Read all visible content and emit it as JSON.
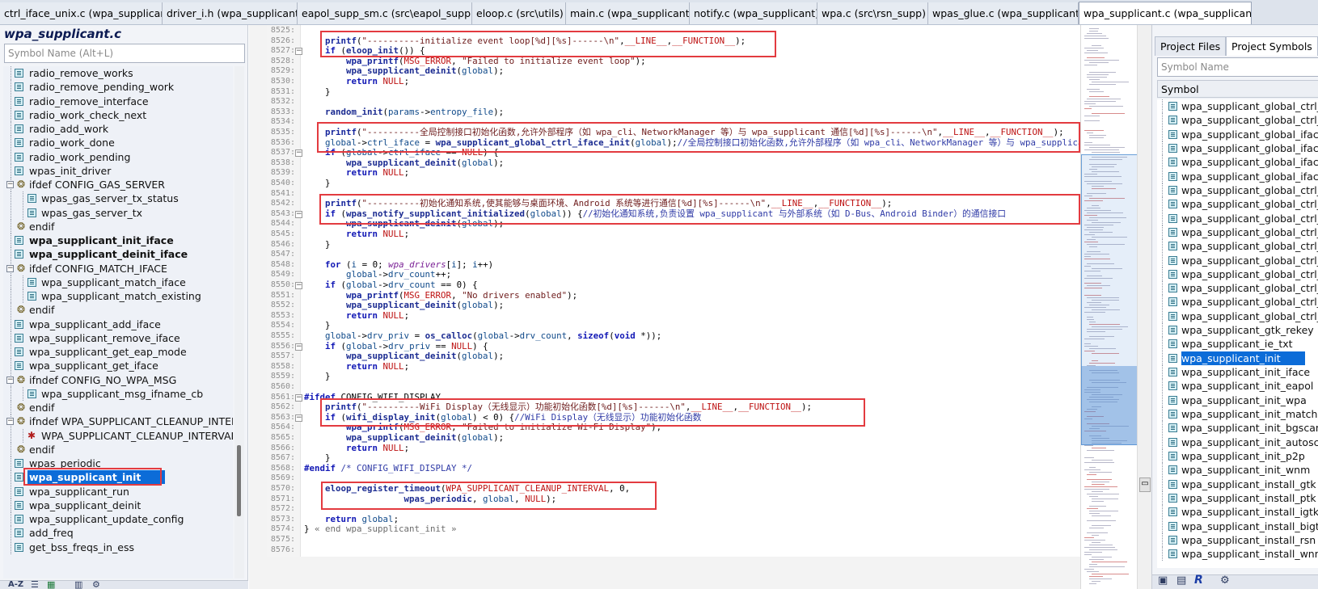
{
  "tabs": [
    {
      "label": "ctrl_iface_unix.c (wpa_supplicant)",
      "active": false
    },
    {
      "label": "driver_i.h (wpa_supplicant)",
      "active": false
    },
    {
      "label": "eapol_supp_sm.c (src\\eapol_supp)",
      "active": false
    },
    {
      "label": "eloop.c (src\\utils)",
      "active": false
    },
    {
      "label": "main.c (wpa_supplicant)",
      "active": false
    },
    {
      "label": "notify.c (wpa_supplicant)",
      "active": false
    },
    {
      "label": "wpa.c (src\\rsn_supp)",
      "active": false
    },
    {
      "label": "wpas_glue.c (wpa_supplicant)",
      "active": false
    },
    {
      "label": "wpa_supplicant.c (wpa_supplicant)",
      "active": true
    }
  ],
  "tab_close_glyph": "✕",
  "left_panel": {
    "file_title": "wpa_supplicant.c",
    "search_placeholder": "Symbol Name (Alt+L)",
    "items": [
      {
        "label": "radio_remove_works",
        "kind": "func",
        "level": 1
      },
      {
        "label": "radio_remove_pending_work",
        "kind": "func",
        "level": 1
      },
      {
        "label": "radio_remove_interface",
        "kind": "func",
        "level": 1
      },
      {
        "label": "radio_work_check_next",
        "kind": "func",
        "level": 1
      },
      {
        "label": "radio_add_work",
        "kind": "func",
        "level": 1
      },
      {
        "label": "radio_work_done",
        "kind": "func",
        "level": 1
      },
      {
        "label": "radio_work_pending",
        "kind": "func",
        "level": 1
      },
      {
        "label": "wpas_init_driver",
        "kind": "func",
        "level": 1
      },
      {
        "label": "ifdef CONFIG_GAS_SERVER",
        "kind": "ifdef",
        "level": 0
      },
      {
        "label": "wpas_gas_server_tx_status",
        "kind": "func",
        "level": 2
      },
      {
        "label": "wpas_gas_server_tx",
        "kind": "func",
        "level": 2
      },
      {
        "label": "endif",
        "kind": "endif",
        "level": 1
      },
      {
        "label": "wpa_supplicant_init_iface",
        "kind": "func",
        "level": 1,
        "bold": true
      },
      {
        "label": "wpa_supplicant_deinit_iface",
        "kind": "func",
        "level": 1,
        "bold": true
      },
      {
        "label": "ifdef CONFIG_MATCH_IFACE",
        "kind": "ifdef",
        "level": 0
      },
      {
        "label": "wpa_supplicant_match_iface",
        "kind": "func",
        "level": 2
      },
      {
        "label": "wpa_supplicant_match_existing",
        "kind": "func",
        "level": 2
      },
      {
        "label": "endif",
        "kind": "endif",
        "level": 1
      },
      {
        "label": "wpa_supplicant_add_iface",
        "kind": "func",
        "level": 1
      },
      {
        "label": "wpa_supplicant_remove_iface",
        "kind": "func",
        "level": 1
      },
      {
        "label": "wpa_supplicant_get_eap_mode",
        "kind": "func",
        "level": 1
      },
      {
        "label": "wpa_supplicant_get_iface",
        "kind": "func",
        "level": 1
      },
      {
        "label": "ifndef CONFIG_NO_WPA_MSG",
        "kind": "ifdef",
        "level": 0
      },
      {
        "label": "wpa_supplicant_msg_ifname_cb",
        "kind": "func",
        "level": 2
      },
      {
        "label": "endif",
        "kind": "endif",
        "level": 1
      },
      {
        "label": "ifndef WPA_SUPPLICANT_CLEANUP_INTERVA",
        "kind": "ifdef",
        "level": 0
      },
      {
        "label": "WPA_SUPPLICANT_CLEANUP_INTERVAL",
        "kind": "macro",
        "level": 2
      },
      {
        "label": "endif",
        "kind": "endif",
        "level": 1
      },
      {
        "label": "wpas_periodic",
        "kind": "func",
        "level": 1
      },
      {
        "label": "wpa_supplicant_init",
        "kind": "func",
        "level": 1,
        "selected": true,
        "bold": true
      },
      {
        "label": "wpa_supplicant_run",
        "kind": "func",
        "level": 1
      },
      {
        "label": "wpa_supplicant_deinit",
        "kind": "func",
        "level": 1
      },
      {
        "label": "wpa_supplicant_update_config",
        "kind": "func",
        "level": 1
      },
      {
        "label": "add_freq",
        "kind": "func",
        "level": 1
      },
      {
        "label": "get_bss_freqs_in_ess",
        "kind": "func",
        "level": 1
      }
    ]
  },
  "editor": {
    "lines": [
      {
        "n": "8525:",
        "fold": "",
        "html": ""
      },
      {
        "n": "8526:",
        "fold": "",
        "html": "    <span class=\"fnh\">printf</span>(<span class=\"st\">\"----------initialize event loop[%d][%s]------\\n\"</span>,<span class=\"mac\">__LINE__</span>,<span class=\"mac\">__FUNCTION__</span>);"
      },
      {
        "n": "8527:",
        "fold": "−",
        "html": "    <span class=\"kw\">if</span> (<span class=\"fn\">eloop_init</span>()) {"
      },
      {
        "n": "8528:",
        "fold": "",
        "html": "        <span class=\"fnh\">wpa_printf</span>(<span class=\"mac\">MSG_ERROR</span>, <span class=\"st\">\"Failed to initialize event loop\"</span>);"
      },
      {
        "n": "8529:",
        "fold": "",
        "html": "        <span class=\"fn\">wpa_supplicant_deinit</span>(<span class=\"id\">global</span>);"
      },
      {
        "n": "8530:",
        "fold": "",
        "html": "        <span class=\"kw\">return</span> <span class=\"mac\">NULL</span>;"
      },
      {
        "n": "8531:",
        "fold": "",
        "html": "    }"
      },
      {
        "n": "8532:",
        "fold": "",
        "html": ""
      },
      {
        "n": "8533:",
        "fold": "",
        "html": "    <span class=\"fn\">random_init</span>(<span class=\"id\">params</span>-><span class=\"id\">entropy_file</span>);"
      },
      {
        "n": "8534:",
        "fold": "",
        "html": ""
      },
      {
        "n": "8535:",
        "fold": "",
        "html": "    <span class=\"fnh\">printf</span>(<span class=\"st\">\"----------全局控制接口初始化函数,允许外部程序（如 wpa_cli、NetworkManager 等）与 wpa_supplicant 通信[%d][%s]------\\n\"</span>,<span class=\"mac\">__LINE__</span>,<span class=\"mac\">__FUNCTION__</span>);"
      },
      {
        "n": "8536:",
        "fold": "",
        "html": "    <span class=\"id\">global</span>-><span class=\"id\">ctrl_iface</span> = <span class=\"fn\">wpa_supplicant_global_ctrl_iface_init</span>(<span class=\"id\">global</span>);<span class=\"cm\">//全局控制接口初始化函数,允许外部程序（如 wpa_cli、NetworkManager 等）与 wpa_supplicant 通信</span>"
      },
      {
        "n": "8537:",
        "fold": "−",
        "html": "    <span class=\"kw\">if</span> (<span class=\"id\">global</span>-><span class=\"id\">ctrl_iface</span> == <span class=\"mac\">NULL</span>) {"
      },
      {
        "n": "8538:",
        "fold": "",
        "html": "        <span class=\"fn\">wpa_supplicant_deinit</span>(<span class=\"id\">global</span>);"
      },
      {
        "n": "8539:",
        "fold": "",
        "html": "        <span class=\"kw\">return</span> <span class=\"mac\">NULL</span>;"
      },
      {
        "n": "8540:",
        "fold": "",
        "html": "    }"
      },
      {
        "n": "8541:",
        "fold": "",
        "html": ""
      },
      {
        "n": "8542:",
        "fold": "",
        "html": "    <span class=\"fnh\">printf</span>(<span class=\"st\">\"----------初始化通知系统,使其能够与桌面环境、Android 系统等进行通信[%d][%s]------\\n\"</span>,<span class=\"mac\">__LINE__</span>,<span class=\"mac\">__FUNCTION__</span>);"
      },
      {
        "n": "8543:",
        "fold": "−",
        "html": "    <span class=\"kw\">if</span> (<span class=\"fn\">wpas_notify_supplicant_initialized</span>(<span class=\"id\">global</span>)) {<span class=\"cm\">//初始化通知系统,负责设置 wpa_supplicant 与外部系统（如 D-Bus、Android Binder）的通信接口</span>"
      },
      {
        "n": "8544:",
        "fold": "",
        "html": "        <span class=\"fn\">wpa_supplicant_deinit</span>(<span class=\"id\">global</span>);"
      },
      {
        "n": "8545:",
        "fold": "",
        "html": "        <span class=\"kw\">return</span> <span class=\"mac\">NULL</span>;"
      },
      {
        "n": "8546:",
        "fold": "",
        "html": "    }"
      },
      {
        "n": "8547:",
        "fold": "",
        "html": ""
      },
      {
        "n": "8548:",
        "fold": "",
        "html": "    <span class=\"kw\">for</span> (<span class=\"id\">i</span> = 0; <span class=\"ita\">wpa_drivers</span>[<span class=\"id\">i</span>]; <span class=\"id\">i</span>++)"
      },
      {
        "n": "8549:",
        "fold": "",
        "html": "        <span class=\"id\">global</span>-><span class=\"id\">drv_count</span>++;"
      },
      {
        "n": "8550:",
        "fold": "−",
        "html": "    <span class=\"kw\">if</span> (<span class=\"id\">global</span>-><span class=\"id\">drv_count</span> == 0) {"
      },
      {
        "n": "8551:",
        "fold": "",
        "html": "        <span class=\"fnh\">wpa_printf</span>(<span class=\"mac\">MSG_ERROR</span>, <span class=\"st\">\"No drivers enabled\"</span>);"
      },
      {
        "n": "8552:",
        "fold": "",
        "html": "        <span class=\"fn\">wpa_supplicant_deinit</span>(<span class=\"id\">global</span>);"
      },
      {
        "n": "8553:",
        "fold": "",
        "html": "        <span class=\"kw\">return</span> <span class=\"mac\">NULL</span>;"
      },
      {
        "n": "8554:",
        "fold": "",
        "html": "    }"
      },
      {
        "n": "8555:",
        "fold": "",
        "html": "    <span class=\"id\">global</span>-><span class=\"id\">drv_priv</span> = <span class=\"fn\">os_calloc</span>(<span class=\"id\">global</span>-><span class=\"id\">drv_count</span>, <span class=\"kw\">sizeof</span>(<span class=\"kw\">void</span> *));"
      },
      {
        "n": "8556:",
        "fold": "−",
        "html": "    <span class=\"kw\">if</span> (<span class=\"id\">global</span>-><span class=\"id\">drv_priv</span> == <span class=\"mac\">NULL</span>) {"
      },
      {
        "n": "8557:",
        "fold": "",
        "html": "        <span class=\"fn\">wpa_supplicant_deinit</span>(<span class=\"id\">global</span>);"
      },
      {
        "n": "8558:",
        "fold": "",
        "html": "        <span class=\"kw\">return</span> <span class=\"mac\">NULL</span>;"
      },
      {
        "n": "8559:",
        "fold": "",
        "html": "    }"
      },
      {
        "n": "8560:",
        "fold": "",
        "html": ""
      },
      {
        "n": "8561:",
        "fold": "−",
        "html": "<span class=\"kw\">#ifdef</span> CONFIG_WIFI_DISPLAY"
      },
      {
        "n": "8562:",
        "fold": "",
        "html": "    <span class=\"fnh\">printf</span>(<span class=\"st\">\"----------WiFi Display（无线显示）功能初始化函数[%d][%s]------\\n\"</span>,<span class=\"mac\">__LINE__</span>,<span class=\"mac\">__FUNCTION__</span>);"
      },
      {
        "n": "8563:",
        "fold": "−",
        "html": "    <span class=\"kw\">if</span> (<span class=\"fn\">wifi_display_init</span>(<span class=\"id\">global</span>) < 0) {<span class=\"cm\">//WiFi Display（无线显示）功能初始化函数</span>"
      },
      {
        "n": "8564:",
        "fold": "",
        "html": "        <span class=\"fnh\">wpa_printf</span>(<span class=\"mac\">MSG_ERROR</span>, <span class=\"st\">\"Failed to initialize Wi-Fi Display\"</span>);"
      },
      {
        "n": "8565:",
        "fold": "",
        "html": "        <span class=\"fn\">wpa_supplicant_deinit</span>(<span class=\"id\">global</span>);"
      },
      {
        "n": "8566:",
        "fold": "",
        "html": "        <span class=\"kw\">return</span> <span class=\"mac\">NULL</span>;"
      },
      {
        "n": "8567:",
        "fold": "",
        "html": "    }"
      },
      {
        "n": "8568:",
        "fold": "",
        "html": "<span class=\"kw\">#endif</span> <span class=\"cm\">/* CONFIG_WIFI_DISPLAY */</span>"
      },
      {
        "n": "8569:",
        "fold": "",
        "html": ""
      },
      {
        "n": "8570:",
        "fold": "",
        "html": "    <span class=\"fn\">eloop_register_timeout</span>(<span class=\"mac\">WPA_SUPPLICANT_CLEANUP_INTERVAL</span>, 0,"
      },
      {
        "n": "8571:",
        "fold": "",
        "html": "                   <span class=\"fn\">wpas_periodic</span>, <span class=\"id\">global</span>, <span class=\"mac\">NULL</span>);"
      },
      {
        "n": "8572:",
        "fold": "",
        "html": ""
      },
      {
        "n": "8573:",
        "fold": "",
        "html": "    <span class=\"kw\">return</span> <span class=\"id\">global</span>;"
      },
      {
        "n": "8574:",
        "fold": "",
        "html": "} <span class=\"cm\" style=\"color:#6c6c6c\">« end wpa_supplicant_init »</span>"
      },
      {
        "n": "8575:",
        "fold": "",
        "html": ""
      },
      {
        "n": "8576:",
        "fold": "",
        "html": ""
      }
    ]
  },
  "right_panel": {
    "tabs": [
      "Project Files",
      "Project Symbols"
    ],
    "active_tab": 1,
    "search_placeholder": "Symbol Name",
    "column_header": "Symbol",
    "items": [
      {
        "label": "wpa_supplicant_global_ctrl_iface_init"
      },
      {
        "label": "wpa_supplicant_global_ctrl_iface_deinit"
      },
      {
        "label": "wpa_supplicant_global_iface_add"
      },
      {
        "label": "wpa_supplicant_global_iface_remove"
      },
      {
        "label": "wpa_supplicant_global_iface_list"
      },
      {
        "label": "wpa_supplicant_global_iface_interfaces"
      },
      {
        "label": "wpa_supplicant_global_ctrl_iface_process"
      },
      {
        "label": "wpa_supplicant_global_ctrl_iface_receive"
      },
      {
        "label": "wpa_supplicant_global_ctrl_iface_send"
      },
      {
        "label": "wpa_supplicant_global_ctrl_iface_open"
      },
      {
        "label": "wpa_supplicant_global_ctrl_iface_close"
      },
      {
        "label": "wpa_supplicant_global_ctrl_iface_attach"
      },
      {
        "label": "wpa_supplicant_global_ctrl_iface_detach"
      },
      {
        "label": "wpa_supplicant_global_ctrl_iface_level"
      },
      {
        "label": "wpa_supplicant_global_ctrl_iface_msg_cb"
      },
      {
        "label": "wpa_supplicant_global_ctrl_iface_ctrl_rsp"
      },
      {
        "label": "wpa_supplicant_gtk_rekey"
      },
      {
        "label": "wpa_supplicant_ie_txt"
      },
      {
        "label": "wpa_supplicant_init",
        "selected": true
      },
      {
        "label": "wpa_supplicant_init_iface"
      },
      {
        "label": "wpa_supplicant_init_eapol"
      },
      {
        "label": "wpa_supplicant_init_wpa"
      },
      {
        "label": "wpa_supplicant_init_match"
      },
      {
        "label": "wpa_supplicant_init_bgscan"
      },
      {
        "label": "wpa_supplicant_init_autoscan"
      },
      {
        "label": "wpa_supplicant_init_p2p"
      },
      {
        "label": "wpa_supplicant_init_wnm"
      },
      {
        "label": "wpa_supplicant_install_gtk"
      },
      {
        "label": "wpa_supplicant_install_ptk"
      },
      {
        "label": "wpa_supplicant_install_igtk"
      },
      {
        "label": "wpa_supplicant_install_bigtk"
      },
      {
        "label": "wpa_supplicant_install_rsn"
      },
      {
        "label": "wpa_supplicant_install_wnm"
      }
    ]
  }
}
